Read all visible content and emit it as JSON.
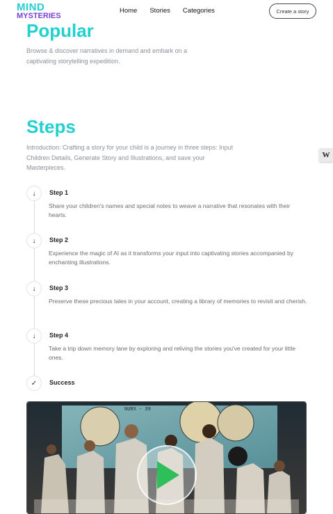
{
  "nav": {
    "logo_line1": "MIND",
    "logo_line2": "MYSTERIES",
    "links": [
      "Home",
      "Stories",
      "Categories"
    ],
    "create_label": "Create a story"
  },
  "popular": {
    "title": "Popular",
    "description": "Browse & discover narratives in demand and embark on a captivating storytelling expedition."
  },
  "steps": {
    "title": "Steps",
    "intro": "Introduction: Crafting a story for your child is a journey in three steps: Input Children Details, Generate Story and Illustrations, and save your Masterpieces.",
    "items": [
      {
        "title": "Step 1",
        "icon": "arrow-down-icon",
        "glyph": "↓",
        "desc": "Share your children's names and special notes to weave a narrative that resonates with their hearts."
      },
      {
        "title": "Step 2",
        "icon": "arrow-down-icon",
        "glyph": "↓",
        "desc": "Experience the magic of AI as it transforms your input into captivating stories accompanied by enchanting illustrations."
      },
      {
        "title": "Step 3",
        "icon": "arrow-down-icon",
        "glyph": "↓",
        "desc": "Preserve these precious tales in your account, creating a library of memories to revisit and cherish."
      },
      {
        "title": "Step 4",
        "icon": "arrow-down-icon",
        "glyph": "↓",
        "desc": "Take a trip down memory lane by exploring and reliving the stories you've created for your little ones."
      },
      {
        "title": "Success",
        "icon": "check-icon",
        "glyph": "✓",
        "desc": ""
      }
    ]
  },
  "side_widget": {
    "label": "W"
  },
  "video": {
    "badge_text": "NURX - 39"
  },
  "colors": {
    "accent": "#22d1cf",
    "play": "#2fbf5a"
  }
}
